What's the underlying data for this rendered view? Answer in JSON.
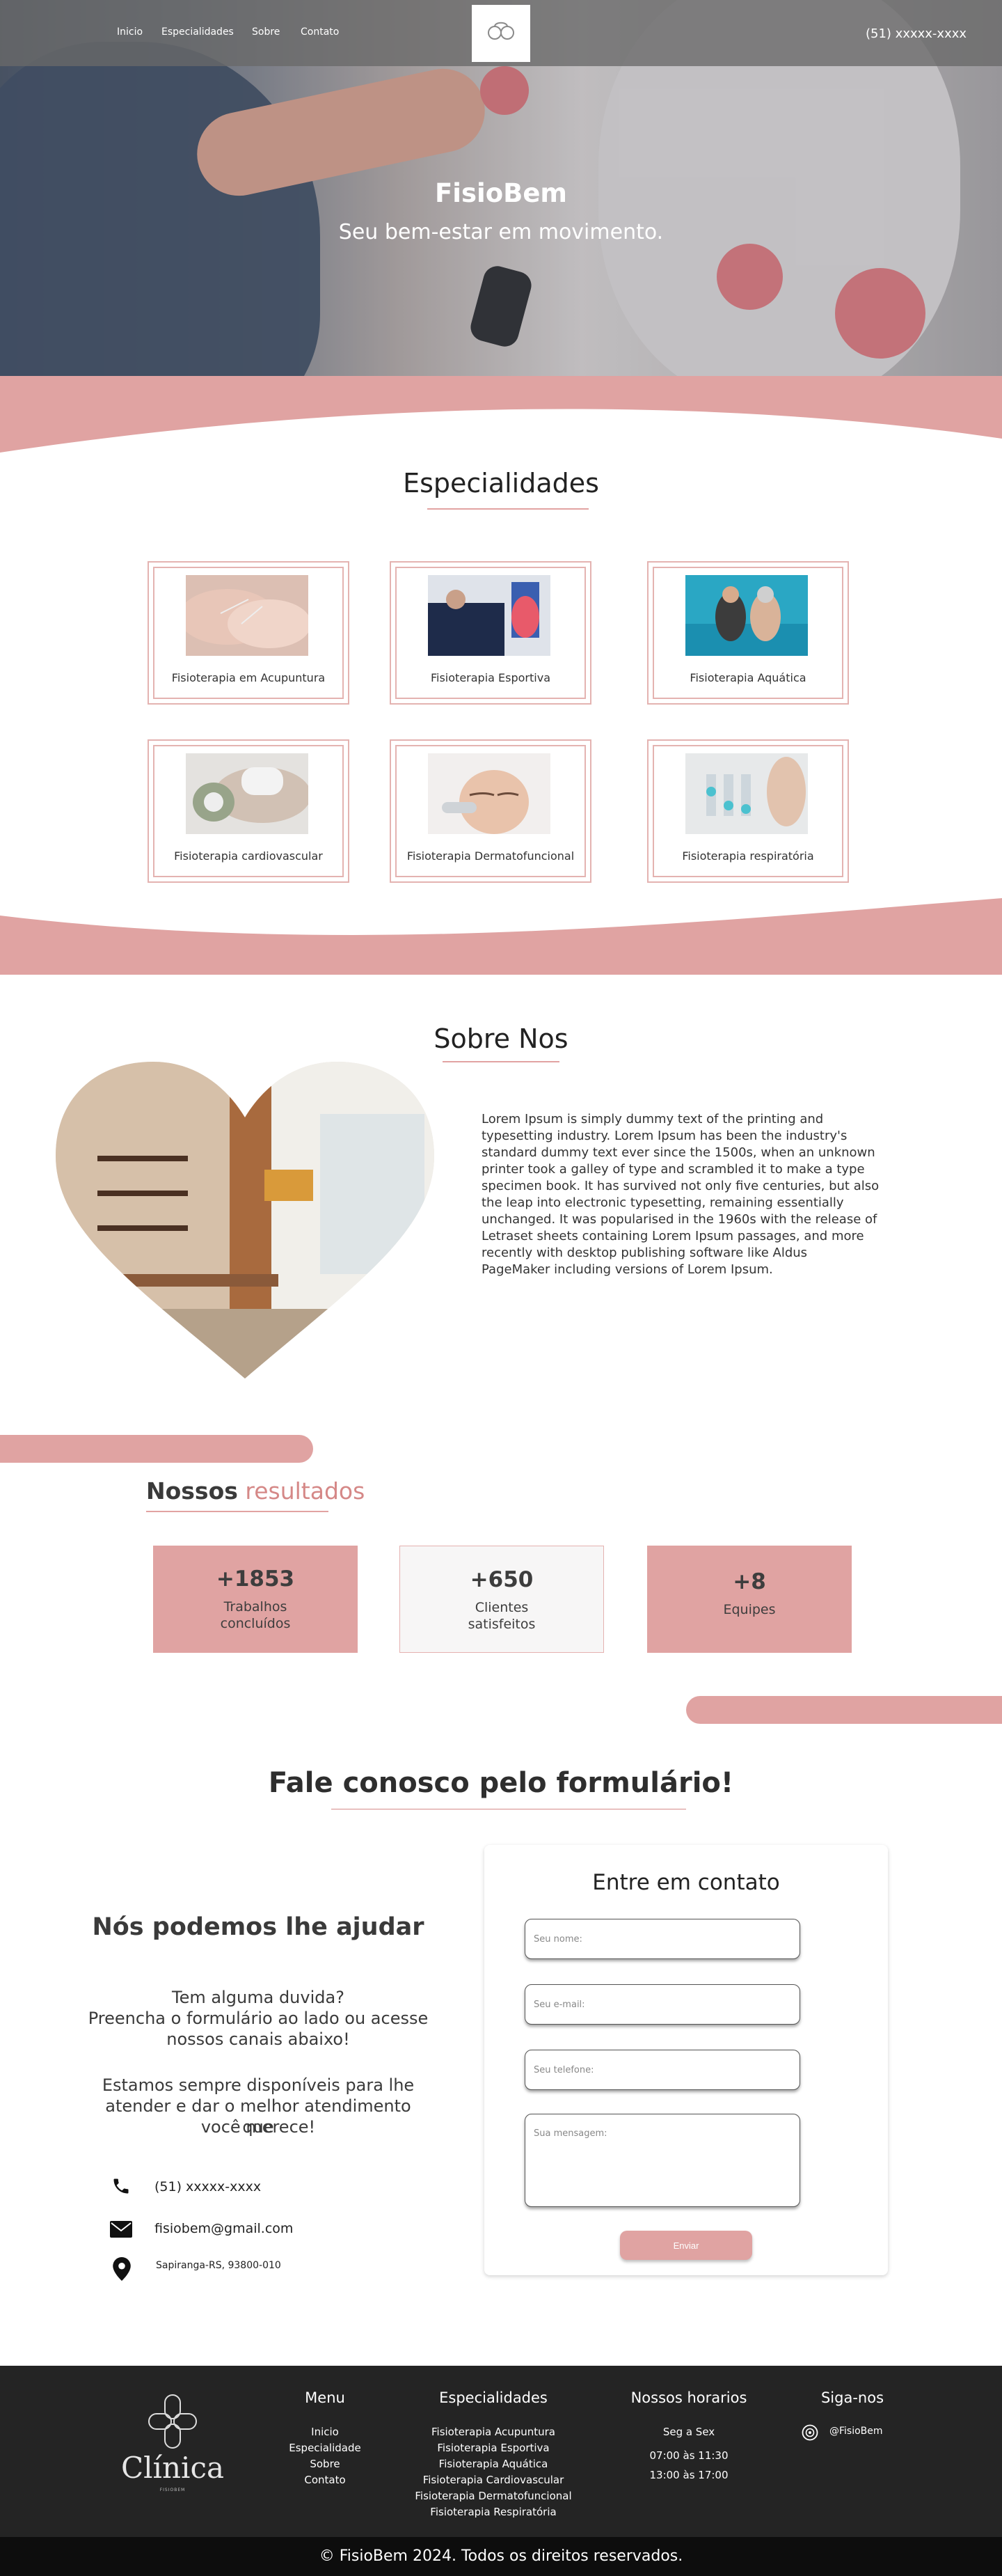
{
  "nav": {
    "links": [
      "Inicio",
      "Especialidades",
      "Sobre",
      "Contato"
    ],
    "phone": "(51) xxxxx-xxxx"
  },
  "hero": {
    "title": "FisioBem",
    "subtitle": "Seu bem-estar em movimento."
  },
  "specialties": {
    "title": "Especialidades",
    "cards": [
      {
        "label": "Fisioterapia em Acupuntura",
        "icon": "acupuncture-photo"
      },
      {
        "label": "Fisioterapia Esportiva",
        "icon": "sports-therapy-photo"
      },
      {
        "label": "Fisioterapia Aquática",
        "icon": "aquatic-therapy-photo"
      },
      {
        "label": "Fisioterapia cardiovascular",
        "icon": "cardio-therapy-photo"
      },
      {
        "label": "Fisioterapia Dermatofuncional",
        "icon": "dermato-therapy-photo"
      },
      {
        "label": "Fisioterapia respiratória",
        "icon": "respiratory-therapy-photo"
      }
    ]
  },
  "about": {
    "title": "Sobre Nos",
    "text": "Lorem Ipsum is simply dummy text of the printing and typesetting industry. Lorem Ipsum has been the industry's standard dummy text ever since the 1500s, when an unknown printer took a galley of type and scrambled it to make a type specimen book. It has survived not only five centuries, but also the leap into electronic typesetting, remaining essentially unchanged. It was popularised in the 1960s with the release of Letraset sheets containing Lorem Ipsum passages, and more recently with desktop publishing software like Aldus PageMaker including versions of Lorem Ipsum."
  },
  "results": {
    "title_part1": "Nossos",
    "title_part2": "resultados",
    "items": [
      {
        "number": "+1853",
        "label_line1": "Trabalhos",
        "label_line2": "concluídos"
      },
      {
        "number": "+650",
        "label_line1": "Clientes",
        "label_line2": "satisfeitos"
      },
      {
        "number": "+8",
        "label_line1": "Equipes",
        "label_line2": ""
      }
    ]
  },
  "contact": {
    "section_title": "Fale conosco pelo formulário!",
    "help_title": "Nós podemos lhe ajudar",
    "help_p1_line1": "Tem alguma duvida?",
    "help_p1_line2": "Preencha o formulário ao lado ou acesse",
    "help_p1_line3": "nossos canais abaixo!",
    "help_p2_line1": "Estamos sempre disponíveis para lhe",
    "help_p2_line2": "atender e dar o melhor atendimento que",
    "help_p2_line3": "você merece!",
    "phone": "(51) xxxxx-xxxx",
    "email": "fisiobem@gmail.com",
    "address": "Sapiranga-RS, 93800-010",
    "form": {
      "title": "Entre em contato",
      "name_placeholder": "Seu nome:",
      "email_placeholder": "Seu e-mail:",
      "phone_placeholder": "Seu telefone:",
      "message_placeholder": "Sua mensagem:",
      "send_label": "Enviar"
    }
  },
  "footer": {
    "brand": "Clínica",
    "brand_sub": "FISIOBEM",
    "menu_title": "Menu",
    "menu_items": [
      "Inicio",
      "Especialidade",
      "Sobre",
      "Contato"
    ],
    "specialties_title": "Especialidades",
    "specialties_items": [
      "Fisioterapia Acupuntura",
      "Fisioterapia Esportiva",
      "Fisioterapia Aquática",
      "Fisioterapia Cardiovascular",
      "Fisioterapia Dermatofuncional",
      "Fisioterapia Respiratória"
    ],
    "hours_title": "Nossos horarios",
    "hours_days": "Seg a Sex",
    "hours_morning": "07:00 às 11:30",
    "hours_afternoon": "13:00 às 17:00",
    "social_title": "Siga-nos",
    "instagram": "@FisioBem",
    "copyright": "© FisioBem 2024. Todos os direitos reservados."
  },
  "colors": {
    "accent": "#e0a3a2",
    "footer_bg": "#242424",
    "copyright_bg": "#0d0d0d"
  }
}
